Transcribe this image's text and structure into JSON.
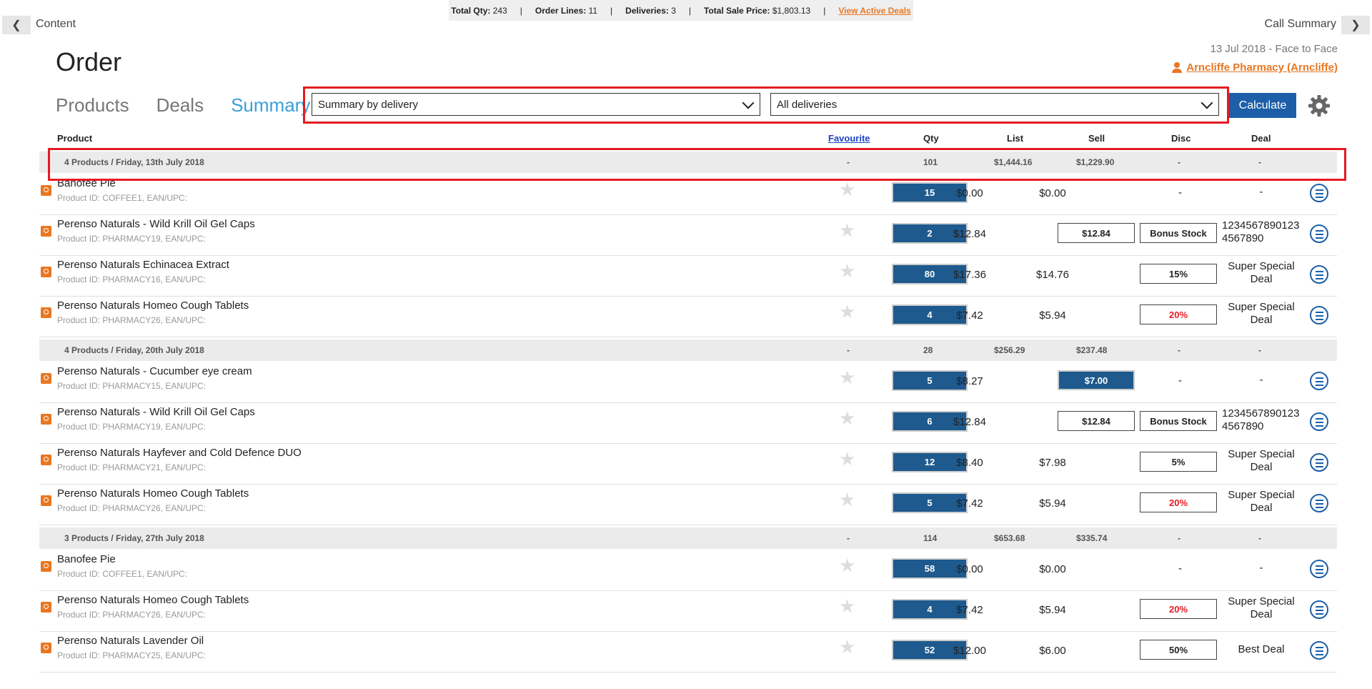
{
  "nav": {
    "left_label": "Content",
    "right_label": "Call Summary"
  },
  "totals": {
    "qty_label": "Total Qty:",
    "qty": "243",
    "lines_label": "Order Lines:",
    "lines": "11",
    "deliveries_label": "Deliveries:",
    "deliveries": "3",
    "price_label": "Total Sale Price:",
    "price": "$1,803.13",
    "deals_link": "View Active Deals"
  },
  "page": {
    "title": "Order",
    "call_date": "13 Jul 2018  -  Face to Face",
    "customer": "Arncliffe Pharmacy (Arncliffe)"
  },
  "tabs": [
    "Products",
    "Deals",
    "Summary"
  ],
  "filters": {
    "summary_mode": "Summary by delivery",
    "delivery": "All deliveries"
  },
  "calculate_label": "Calculate",
  "columns": {
    "product": "Product",
    "favourite": "Favourite",
    "qty": "Qty",
    "list": "List",
    "sell": "Sell",
    "disc": "Disc",
    "deal": "Deal"
  },
  "groups": [
    {
      "label": "4 Products / Friday, 13th July 2018",
      "fav": "-",
      "qty": "101",
      "list": "$1,444.16",
      "sell": "$1,229.90",
      "disc": "-",
      "deal": "-",
      "rows": [
        {
          "name": "Banofee Pie",
          "id": "Product ID: COFFEE1, EAN/UPC:",
          "qty": "15",
          "list": "$0.00",
          "sell": "$0.00",
          "disc": "-",
          "deal": "-"
        },
        {
          "name": "Perenso Naturals - Wild Krill Oil Gel Caps",
          "id": "Product ID: PHARMACY19, EAN/UPC:",
          "qty": "2",
          "list": "$12.84",
          "sell": "$12.84",
          "disc": "Bonus Stock",
          "deal": "12345678901234567890"
        },
        {
          "name": "Perenso Naturals Echinacea Extract",
          "id": "Product ID: PHARMACY16, EAN/UPC:",
          "qty": "80",
          "list": "$17.36",
          "sell": "$14.76",
          "disc": "15%",
          "deal": "Super Special Deal"
        },
        {
          "name": "Perenso Naturals Homeo Cough Tablets",
          "id": "Product ID: PHARMACY26, EAN/UPC:",
          "qty": "4",
          "list": "$7.42",
          "sell": "$5.94",
          "disc": "20%",
          "deal": "Super Special Deal"
        }
      ]
    },
    {
      "label": "4 Products / Friday, 20th July 2018",
      "fav": "-",
      "qty": "28",
      "list": "$256.29",
      "sell": "$237.48",
      "disc": "-",
      "deal": "-",
      "rows": [
        {
          "name": "Perenso Naturals - Cucumber eye cream",
          "id": "Product ID: PHARMACY15, EAN/UPC:",
          "qty": "5",
          "list": "$8.27",
          "sell": "$7.00",
          "disc": "-",
          "deal": "-"
        },
        {
          "name": "Perenso Naturals - Wild Krill Oil Gel Caps",
          "id": "Product ID: PHARMACY19, EAN/UPC:",
          "qty": "6",
          "list": "$12.84",
          "sell": "$12.84",
          "disc": "Bonus Stock",
          "deal": "12345678901234567890"
        },
        {
          "name": "Perenso Naturals Hayfever and Cold Defence DUO",
          "id": "Product ID: PHARMACY21, EAN/UPC:",
          "qty": "12",
          "list": "$8.40",
          "sell": "$7.98",
          "disc": "5%",
          "deal": "Super Special Deal"
        },
        {
          "name": "Perenso Naturals Homeo Cough Tablets",
          "id": "Product ID: PHARMACY26, EAN/UPC:",
          "qty": "5",
          "list": "$7.42",
          "sell": "$5.94",
          "disc": "20%",
          "deal": "Super Special Deal"
        }
      ]
    },
    {
      "label": "3 Products / Friday, 27th July 2018",
      "fav": "-",
      "qty": "114",
      "list": "$653.68",
      "sell": "$335.74",
      "disc": "-",
      "deal": "-",
      "rows": [
        {
          "name": "Banofee Pie",
          "id": "Product ID: COFFEE1, EAN/UPC:",
          "qty": "58",
          "list": "$0.00",
          "sell": "$0.00",
          "disc": "-",
          "deal": "-"
        },
        {
          "name": "Perenso Naturals Homeo Cough Tablets",
          "id": "Product ID: PHARMACY26, EAN/UPC:",
          "qty": "4",
          "list": "$7.42",
          "sell": "$5.94",
          "disc": "20%",
          "deal": "Super Special Deal"
        },
        {
          "name": "Perenso Naturals Lavender Oil",
          "id": "Product ID: PHARMACY25, EAN/UPC:",
          "qty": "52",
          "list": "$12.00",
          "sell": "$6.00",
          "disc": "50%",
          "deal": "Best Deal"
        }
      ]
    }
  ],
  "colors": {
    "accent": "#1c5ea8",
    "qty_fill": "#1e5a8e",
    "link_orange": "#e87722",
    "highlight_red": "#e41b23",
    "summary_blue": "#3aa0d8"
  }
}
